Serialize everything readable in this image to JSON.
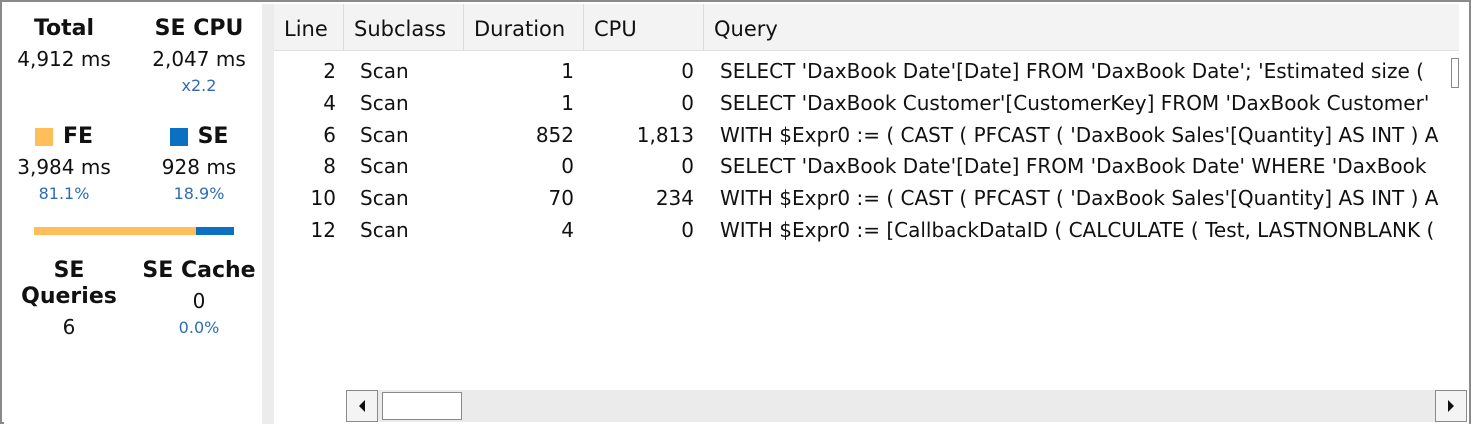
{
  "stats": {
    "total": {
      "label": "Total",
      "value": "4,912 ms"
    },
    "se_cpu": {
      "label": "SE CPU",
      "value": "2,047 ms",
      "ratio": "x2.2"
    },
    "fe": {
      "label": "FE",
      "value": "3,984 ms",
      "pct": "81.1%"
    },
    "se": {
      "label": "SE",
      "value": "928 ms",
      "pct": "18.9%"
    },
    "fe_se_split": {
      "fe_fraction": 0.811,
      "se_fraction": 0.189
    },
    "se_queries": {
      "label": "SE Queries",
      "value": "6"
    },
    "se_cache": {
      "label": "SE Cache",
      "value": "0",
      "pct": "0.0%"
    }
  },
  "colors": {
    "fe": "#ffbe5a",
    "se": "#0b6fc2",
    "accent_text": "#2e6db4"
  },
  "grid": {
    "columns": [
      "Line",
      "Subclass",
      "Duration",
      "CPU",
      "Query"
    ],
    "rows": [
      {
        "line": "2",
        "subclass": "Scan",
        "duration": "1",
        "cpu": "0",
        "query": "SELECT 'DaxBook Date'[Date] FROM 'DaxBook Date';   'Estimated size ("
      },
      {
        "line": "4",
        "subclass": "Scan",
        "duration": "1",
        "cpu": "0",
        "query": "SELECT 'DaxBook Customer'[CustomerKey] FROM 'DaxBook Customer'"
      },
      {
        "line": "6",
        "subclass": "Scan",
        "duration": "852",
        "cpu": "1,813",
        "query": "WITH $Expr0 := ( CAST ( PFCAST ( 'DaxBook Sales'[Quantity] AS  INT ) A"
      },
      {
        "line": "8",
        "subclass": "Scan",
        "duration": "0",
        "cpu": "0",
        "query": "SELECT 'DaxBook Date'[Date] FROM 'DaxBook Date' WHERE 'DaxBook"
      },
      {
        "line": "10",
        "subclass": "Scan",
        "duration": "70",
        "cpu": "234",
        "query": "WITH $Expr0 := ( CAST ( PFCAST ( 'DaxBook Sales'[Quantity] AS  INT ) A"
      },
      {
        "line": "12",
        "subclass": "Scan",
        "duration": "4",
        "cpu": "0",
        "query": "WITH $Expr0 := [CallbackDataID ( CALCULATE ( Test, LASTNONBLANK ("
      }
    ]
  }
}
